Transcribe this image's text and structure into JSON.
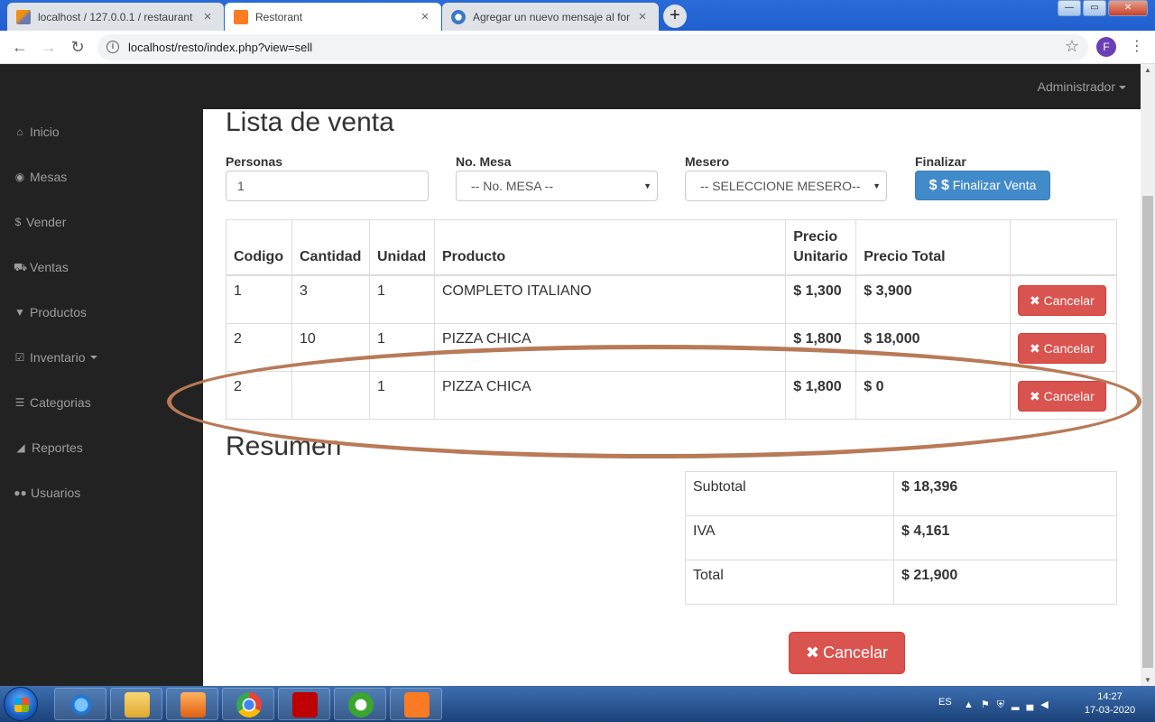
{
  "browser": {
    "tabs": [
      {
        "title": "localhost / 127.0.0.1 / restaurant"
      },
      {
        "title": "Restorant"
      },
      {
        "title": "Agregar un nuevo mensaje al for"
      }
    ],
    "url": "localhost/resto/index.php?view=sell",
    "profile_initial": "F"
  },
  "navbar": {
    "user": "Administrador"
  },
  "sidebar": {
    "items": [
      {
        "label": "Inicio",
        "icon": "home-icon"
      },
      {
        "label": "Mesas",
        "icon": "eye-icon"
      },
      {
        "label": "Vender",
        "icon": "dollar-icon"
      },
      {
        "label": "Ventas",
        "icon": "cart-icon"
      },
      {
        "label": "Productos",
        "icon": "filter-icon"
      },
      {
        "label": "Inventario",
        "icon": "checkbox-icon"
      },
      {
        "label": "Categorias",
        "icon": "list-icon"
      },
      {
        "label": "Reportes",
        "icon": "chart-icon"
      },
      {
        "label": "Usuarios",
        "icon": "users-icon"
      }
    ]
  },
  "page": {
    "title": "Lista de venta",
    "form": {
      "personas_label": "Personas",
      "personas_value": "1",
      "mesa_label": "No. Mesa",
      "mesa_value": "-- No. MESA --",
      "mesero_label": "Mesero",
      "mesero_value": "-- SELECCIONE MESERO--",
      "finalizar_label": "Finalizar",
      "finalizar_button": "Finalizar Venta",
      "finalizar_prefix": "$ $"
    },
    "table": {
      "headers": [
        "Codigo",
        "Cantidad",
        "Unidad",
        "Producto",
        "Precio",
        "Unitario",
        "Precio Total"
      ],
      "rows": [
        {
          "codigo": "1",
          "cantidad": "3",
          "unidad": "1",
          "producto": "COMPLETO ITALIANO",
          "unitario": "$ 1,300",
          "total": "$ 3,900"
        },
        {
          "codigo": "2",
          "cantidad": "10",
          "unidad": "1",
          "producto": "PIZZA CHICA",
          "unitario": "$ 1,800",
          "total": "$ 18,000"
        },
        {
          "codigo": "2",
          "cantidad": "",
          "unidad": "1",
          "producto": "PIZZA CHICA",
          "unitario": "$ 1,800",
          "total": "$ 0"
        }
      ],
      "cancel_label": "Cancelar"
    },
    "resumen": {
      "title": "Resumen",
      "subtotal_label": "Subtotal",
      "subtotal_value": "$ 18,396",
      "iva_label": "IVA",
      "iva_value": "$ 4,161",
      "total_label": "Total",
      "total_value": "$ 21,900"
    },
    "cancel_button": "Cancelar"
  },
  "taskbar": {
    "lang": "ES",
    "time": "14:27",
    "date": "17-03-2020"
  },
  "colors": {
    "primary": "#428bca",
    "danger": "#d9534f",
    "navbar": "#222222",
    "annotation": "#b87a57"
  }
}
